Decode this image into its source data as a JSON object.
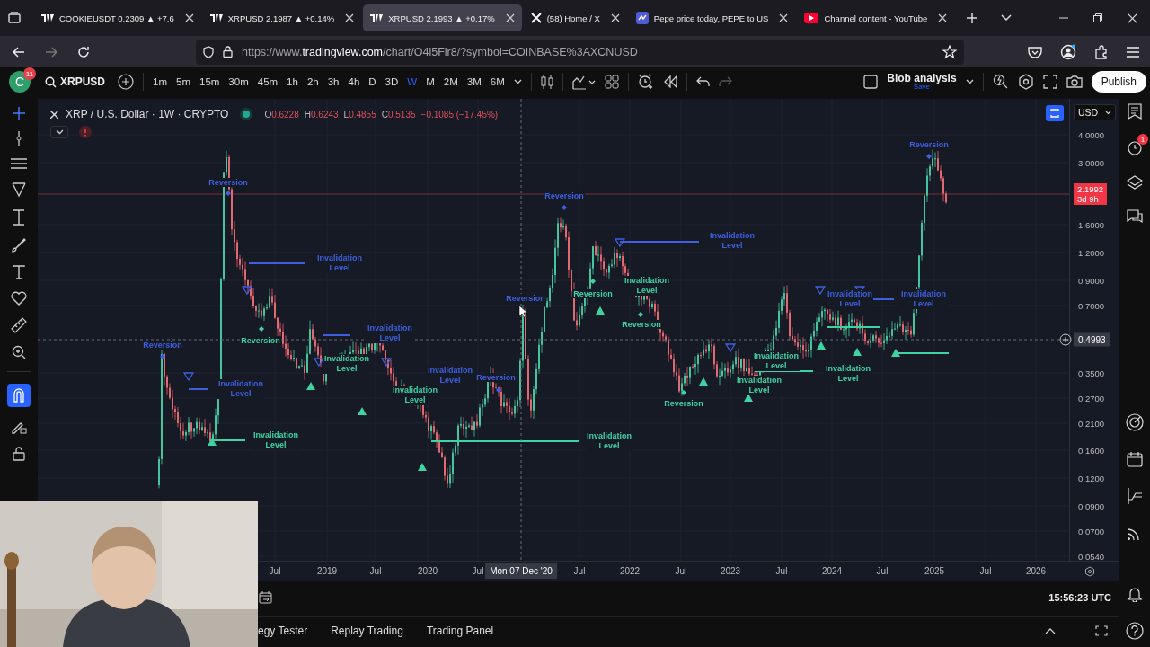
{
  "browser": {
    "tabs": [
      {
        "title": "COOKIEUSDT 0.2309 ▲ +7.6",
        "kind": "tv",
        "selected": false
      },
      {
        "title": "XRPUSD 2.1987 ▲ +0.14%",
        "kind": "tv",
        "selected": false
      },
      {
        "title": "XRPUSD 2.1993 ▲ +0.17%",
        "kind": "tv",
        "selected": true
      },
      {
        "title": "(58) Home / X",
        "kind": "x",
        "selected": false
      },
      {
        "title": "Pepe price today, PEPE to US",
        "kind": "cmc",
        "selected": false
      },
      {
        "title": "Channel content - YouTube",
        "kind": "yt",
        "selected": false
      }
    ],
    "url": {
      "prefix": "https://www.",
      "domain": "tradingview.com",
      "path": "/chart/O4l5Flr8/?symbol=COINBASE%3AXCNUSD"
    }
  },
  "toolbar": {
    "avatar": "C",
    "avatar_badge": "11",
    "symbol": "XRPUSD",
    "intervals": [
      {
        "label": "1m",
        "selected": false
      },
      {
        "label": "5m",
        "selected": false
      },
      {
        "label": "15m",
        "selected": false
      },
      {
        "label": "30m",
        "selected": false
      },
      {
        "label": "45m",
        "selected": false
      },
      {
        "label": "1h",
        "selected": false
      },
      {
        "label": "2h",
        "selected": false
      },
      {
        "label": "3h",
        "selected": false
      },
      {
        "label": "4h",
        "selected": false
      },
      {
        "label": "D",
        "selected": false
      },
      {
        "label": "3D",
        "selected": false
      },
      {
        "label": "W",
        "selected": true
      },
      {
        "label": "M",
        "selected": false
      },
      {
        "label": "2M",
        "selected": false
      },
      {
        "label": "3M",
        "selected": false
      },
      {
        "label": "6M",
        "selected": false
      }
    ],
    "layout_name": "Blob analysis",
    "save_label": "Save",
    "publish": "Publish"
  },
  "chart": {
    "title": "XRP / U.S. Dollar · 1W · CRYPTO",
    "ohlc": [
      {
        "label": "O",
        "value": "0.6228"
      },
      {
        "label": "H",
        "value": "0.6243"
      },
      {
        "label": "L",
        "value": "0.4855"
      },
      {
        "label": "C",
        "value": "0.5135"
      }
    ],
    "change": "−0.1085 (−17.45%)",
    "currency": "USD",
    "price_ticks": [
      "4.0000",
      "3.0000",
      "1.6000",
      "1.2000",
      "0.9000",
      "0.7000",
      "0.3500",
      "0.2700",
      "0.2100",
      "0.1600",
      "0.1200",
      "0.0900",
      "0.0700",
      "0.0540"
    ],
    "last_price": {
      "value": "2.1992",
      "countdown": "3d 9h"
    },
    "crosshair_price": "0.4993",
    "crosshair_date": "Mon 07 Dec '20",
    "time_ticks": [
      "Jul",
      "2019",
      "Jul",
      "2020",
      "Jul",
      "Jul",
      "2022",
      "Jul",
      "2023",
      "Jul",
      "2024",
      "Jul",
      "2025",
      "Jul",
      "2026"
    ],
    "annotations": [
      {
        "kind": "reversion",
        "text": "Reversion",
        "color": "#3f5fe0"
      },
      {
        "kind": "reversion",
        "text": "Reversion",
        "color": "#3f5fe0"
      },
      {
        "kind": "reversion",
        "text": "Reversion",
        "color": "#3f5fe0"
      },
      {
        "kind": "invalidation",
        "text": "Invalidation Level",
        "color": "#3f5fe0"
      },
      {
        "kind": "invalidation",
        "text": "Invalidation Level",
        "color": "#3f5fe0"
      },
      {
        "kind": "invalidation",
        "text": "Invalidation Level",
        "color": "#3ed3a3"
      },
      {
        "kind": "reversion",
        "text": "Reversion",
        "color": "#3ed3a3"
      },
      {
        "kind": "reversion",
        "text": "Reversion",
        "color": "#3f5fe0"
      },
      {
        "kind": "invalidation",
        "text": "Invalidation Level",
        "color": "#3f5fe0"
      },
      {
        "kind": "invalidation",
        "text": "Invalidation Level",
        "color": "#3f5fe0"
      },
      {
        "kind": "reversion",
        "text": "Reversion",
        "color": "#3ed3a3"
      },
      {
        "kind": "reversion",
        "text": "Reversion",
        "color": "#3f5fe0"
      },
      {
        "kind": "reversion",
        "text": "Reversion",
        "color": "#3ed3a3"
      },
      {
        "kind": "invalidation",
        "text": "Invalidation Level",
        "color": "#3f5fe0"
      },
      {
        "kind": "invalidation",
        "text": "Invalidation Level",
        "color": "#3ed3a3"
      },
      {
        "kind": "invalidation",
        "text": "Invalidation Level",
        "color": "#3ed3a3"
      },
      {
        "kind": "invalidation",
        "text": "Invalidation Level",
        "color": "#3f5fe0"
      },
      {
        "kind": "invalidation",
        "text": "Invalidation Level",
        "color": "#3ed3a3"
      },
      {
        "kind": "invalidation",
        "text": "Invalidation Level",
        "color": "#3f5fe0"
      },
      {
        "kind": "reversion",
        "text": "Reversion",
        "color": "#3f5fe0"
      },
      {
        "kind": "invalidation",
        "text": "Invalidation Level",
        "color": "#3ed3a3"
      },
      {
        "kind": "invalidation",
        "text": "Invalidation Level",
        "color": "#3ed3a3"
      },
      {
        "kind": "reversion",
        "text": "Reversion",
        "color": "#3ed3a3"
      },
      {
        "kind": "invalidation",
        "text": "Invalidation Level",
        "color": "#3ed3a3"
      },
      {
        "kind": "invalidation",
        "text": "Invalidation Level",
        "color": "#3ed3a3"
      }
    ]
  },
  "clock": "15:56:23 UTC",
  "bottom_tabs": [
    "egy Tester",
    "Replay Trading",
    "Trading Panel"
  ],
  "sidebar": {
    "alerts_badge": "1"
  }
}
